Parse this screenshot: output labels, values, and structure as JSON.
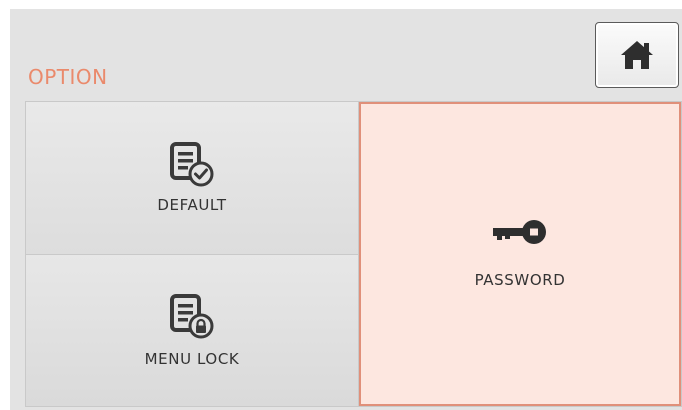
{
  "header": {
    "title": "OPTION",
    "home_icon": "home-icon"
  },
  "colors": {
    "title": "#ea8a6c",
    "selected_tile_bg": "#fde7e0",
    "selected_tile_border": "#e0907a",
    "tile_bg": "#e3e3e3"
  },
  "options": {
    "default": {
      "label": "DEFAULT",
      "icon": "document-check-icon"
    },
    "menu_lock": {
      "label": "MENU LOCK",
      "icon": "document-lock-icon"
    },
    "password": {
      "label": "PASSWORD",
      "icon": "key-icon",
      "selected": true
    }
  }
}
